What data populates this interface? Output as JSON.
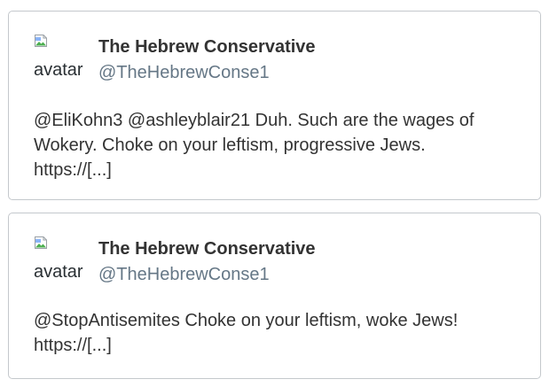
{
  "tweets": [
    {
      "avatar_alt": "avatar",
      "name": "The Hebrew Conservative",
      "handle": "@TheHebrewConse1",
      "text_lines": [
        "@EliKohn3 @ashleyblair21 Duh. Such are the wages of",
        "Wokery. Choke on your leftism, progressive Jews.",
        "https://[...]"
      ]
    },
    {
      "avatar_alt": "avatar",
      "name": "The Hebrew Conservative",
      "handle": "@TheHebrewConse1",
      "text_lines": [
        "@StopAntisemites Choke on your leftism, woke Jews!",
        "https://[...]"
      ]
    }
  ],
  "colors": {
    "name": "#333333",
    "handle": "#657786",
    "border": "#c4c8cc"
  },
  "icons": {
    "avatar_placeholder": "broken-image-icon"
  }
}
